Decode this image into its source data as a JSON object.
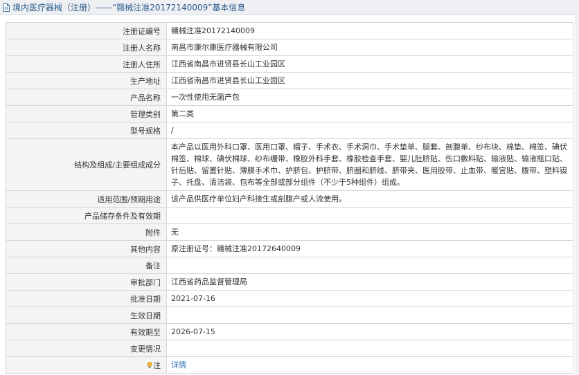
{
  "header": {
    "title": "境内医疗器械（注册）——“赣械注准20172140009”基本信息"
  },
  "rows": [
    {
      "label": "注册证编号",
      "value": "赣械注准20172140009"
    },
    {
      "label": "注册人名称",
      "value": "南昌市康尔康医疗器械有限公司"
    },
    {
      "label": "注册人住所",
      "value": "江西省南昌市进贤县长山工业园区"
    },
    {
      "label": "生产地址",
      "value": "江西省南昌市进贤县长山工业园区"
    },
    {
      "label": "产品名称",
      "value": "一次性使用无菌产包"
    },
    {
      "label": "管理类别",
      "value": "第二类"
    },
    {
      "label": "型号规格",
      "value": "/"
    },
    {
      "label": "结构及组成/主要组成成分",
      "value": "本产品以医用外科口罩、医用口罩、帽子、手术衣、手术洞巾、手术垫单、腿套、剖腹单、纱布块、棉垫、棉签、碘伏棉签、棉球、碘伏棉球、纱布绷带、橡胶外科手套、橡胶检查手套、婴儿肚脐贴、伤口敷料贴、输液贴、输液瓶口贴、针后贴、留置针贴、薄膜手术巾、护脐包、护脐带、脐圈和脐线、脐带夹、医用胶带、止血带、暖宫贴、腹带、塑料镊子、托盘、清洁袋、包布等全部或部分组件（不少于5种组件）组成。"
    },
    {
      "label": "适用范围/预期用途",
      "value": "该产品供医疗单位妇产科接生或剖腹产或人流使用。"
    },
    {
      "label": "产品储存条件及有效期",
      "value": ""
    },
    {
      "label": "附件",
      "value": "无"
    },
    {
      "label": "其他内容",
      "value": "原注册证号：赣械注准20172640009"
    },
    {
      "label": "备注",
      "value": ""
    },
    {
      "label": "审批部门",
      "value": "江西省药品监督管理局"
    },
    {
      "label": "批准日期",
      "value": "2021-07-16"
    },
    {
      "label": "生效日期",
      "value": ""
    },
    {
      "label": "有效期至",
      "value": "2026-07-15"
    },
    {
      "label": "变更情况",
      "value": ""
    }
  ],
  "note_row": {
    "label": "注",
    "link_text": "详情"
  },
  "colors": {
    "link": "#2a6fb8",
    "title": "#2a5a8a",
    "label_bg": "#f4f4f4",
    "border": "#d6d6d6"
  },
  "icons": {
    "title": "document-icon",
    "note": "lightbulb-icon"
  }
}
